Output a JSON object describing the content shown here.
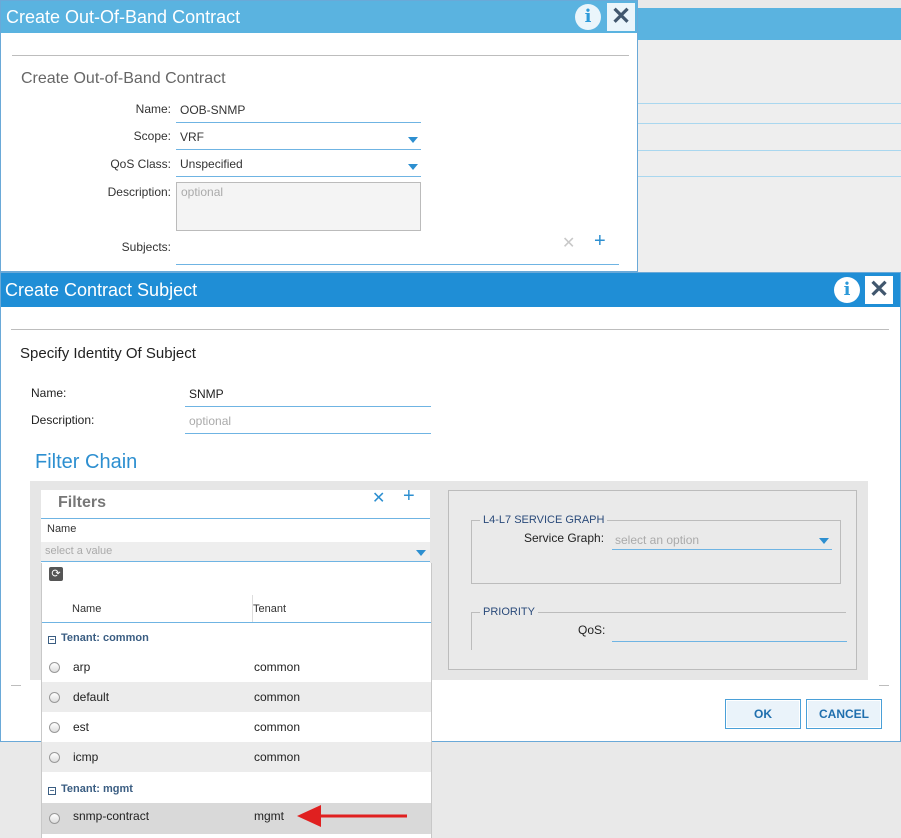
{
  "outer_dialog": {
    "title": "Create Out-Of-Band Contract",
    "heading": "Create Out-of-Band Contract",
    "name_label": "Name:",
    "name_value": "OOB-SNMP",
    "scope_label": "Scope:",
    "scope_value": "VRF",
    "qos_label": "QoS Class:",
    "qos_value": "Unspecified",
    "description_label": "Description:",
    "description_placeholder": "optional",
    "subjects_label": "Subjects:"
  },
  "subject_dialog": {
    "title": "Create Contract Subject",
    "section_heading": "Specify Identity Of Subject",
    "name_label": "Name:",
    "name_value": "SNMP",
    "description_label": "Description:",
    "description_placeholder": "optional",
    "filter_chain_heading": "Filter Chain",
    "filters": {
      "title": "Filters",
      "name_column": "Name",
      "select_placeholder": "select a value"
    },
    "dropdown": {
      "col_name": "Name",
      "col_tenant": "Tenant",
      "groups": [
        {
          "label": "Tenant: common",
          "rows": [
            {
              "name": "arp",
              "tenant": "common"
            },
            {
              "name": "default",
              "tenant": "common"
            },
            {
              "name": "est",
              "tenant": "common"
            },
            {
              "name": "icmp",
              "tenant": "common"
            }
          ]
        },
        {
          "label": "Tenant: mgmt",
          "rows": [
            {
              "name": "snmp-contract",
              "tenant": "mgmt"
            }
          ]
        }
      ]
    },
    "service_graph": {
      "legend": "L4-L7 SERVICE GRAPH",
      "label": "Service Graph:",
      "placeholder": "select an option"
    },
    "priority": {
      "legend": "PRIORITY",
      "qos_label": "QoS:"
    },
    "ok_label": "OK",
    "cancel_label": "CANCEL"
  },
  "colors": {
    "title_bar_outer": "#5ab3e0",
    "title_bar_main": "#1f8ed6",
    "accent": "#2d8fd0",
    "arrow": "#e02020"
  }
}
